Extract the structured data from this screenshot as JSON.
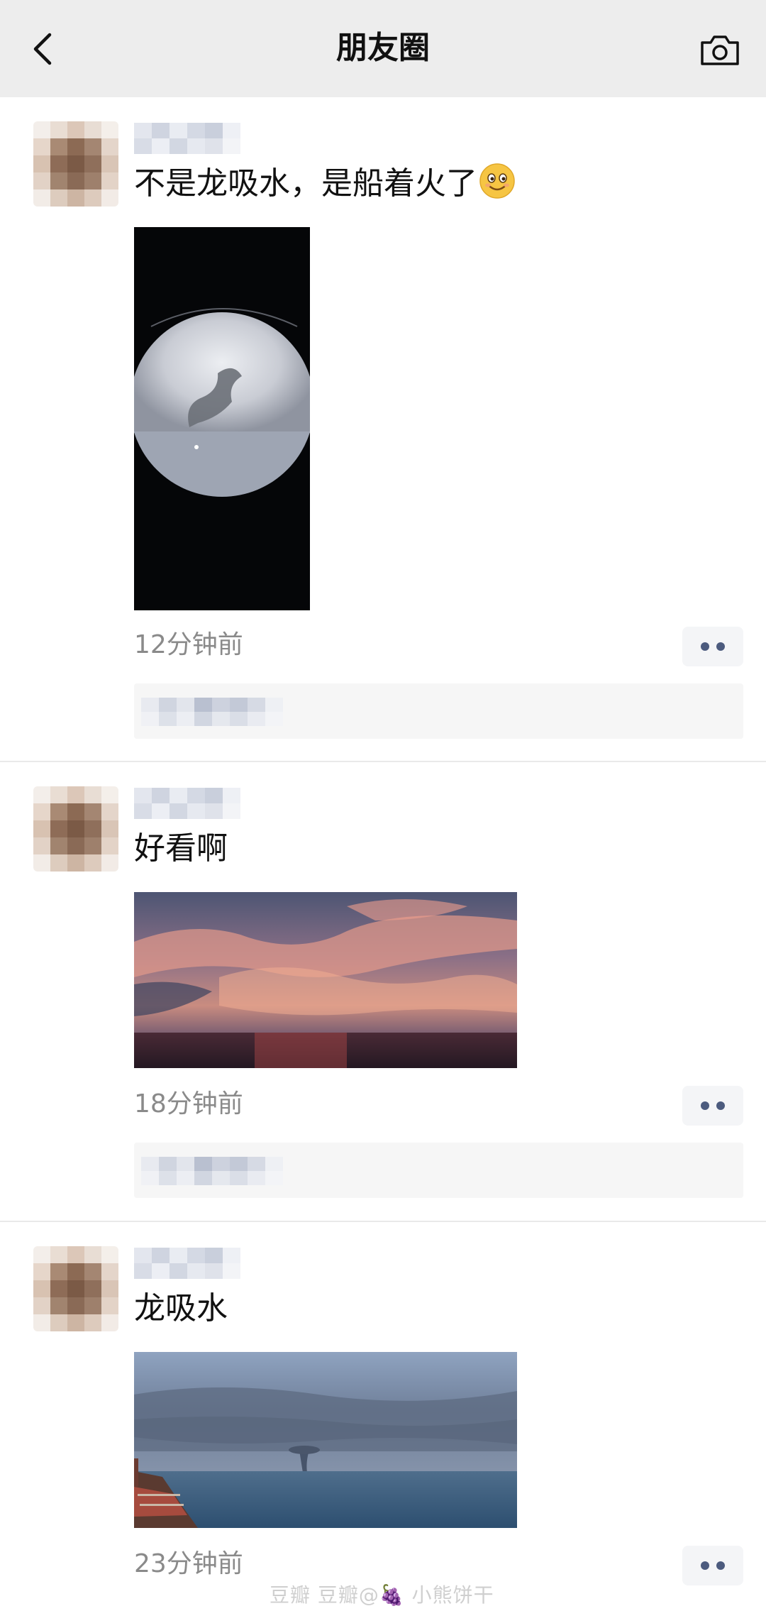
{
  "header": {
    "title": "朋友圈",
    "back_icon": "chevron-left-icon",
    "camera_icon": "camera-icon",
    "background": "#ededed"
  },
  "posts": [
    {
      "text": "不是龙吸水，是船着火了",
      "emoji": "smiling-face-icon",
      "time": "12分钟前",
      "image": "night sea through binoculars"
    },
    {
      "text": "好看啊",
      "time": "18分钟前",
      "image": "sunset clouds over sea"
    },
    {
      "text": "龙吸水",
      "time": "23分钟前",
      "image": "waterspout over sea from ship deck"
    }
  ],
  "watermark": "豆瓣  豆瓣@🍇 小熊饼干",
  "colors": {
    "more_dots": "#4c5b7e",
    "time_text": "#8a8a8a",
    "likes_bg": "#f6f6f6"
  }
}
